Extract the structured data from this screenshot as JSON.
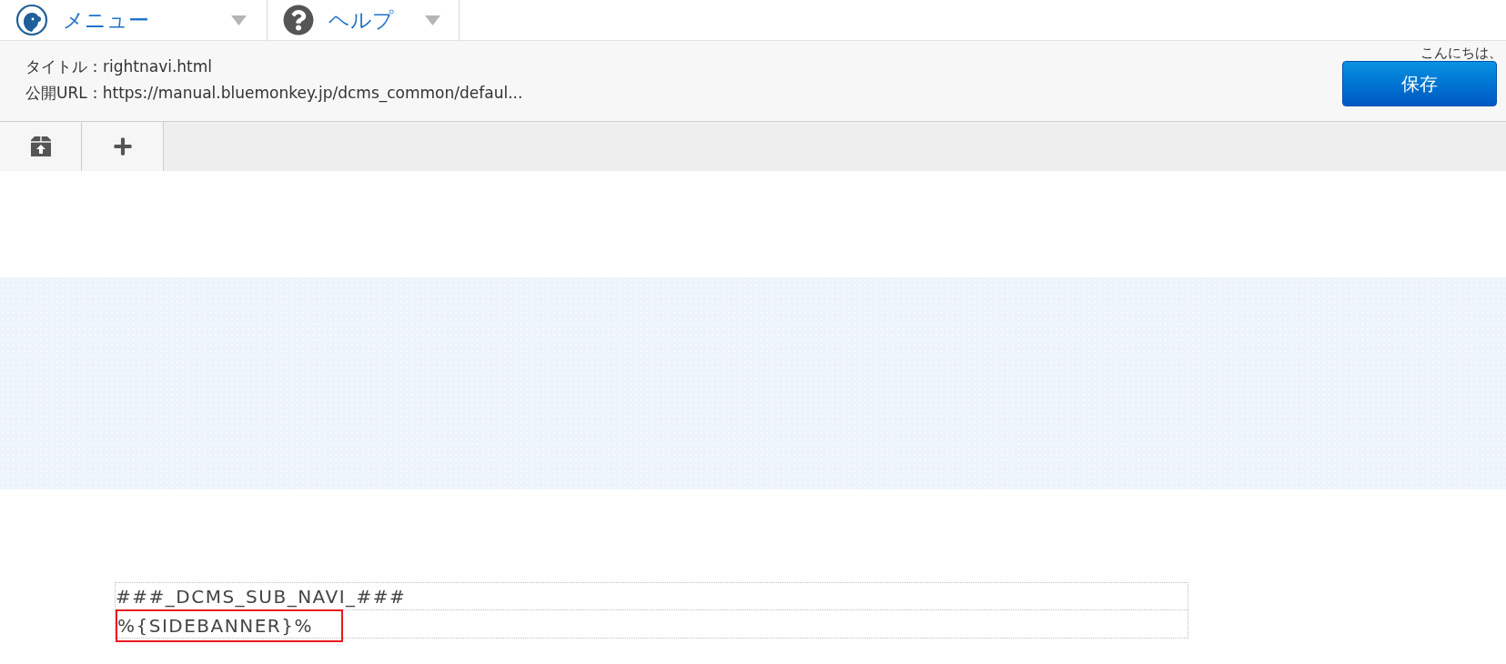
{
  "menubar": {
    "items": [
      {
        "label": "メニュー",
        "kind": "monkey"
      },
      {
        "label": "ヘルプ",
        "kind": "help"
      }
    ]
  },
  "header": {
    "title_line": "タイトル：rightnavi.html",
    "url_line": "公開URL：https://manual.bluemonkey.jp/dcms_common/defaul...",
    "greeting": "こんにちは、",
    "save_button": "保存"
  },
  "toolbar": {
    "items": [
      {
        "kind": "box-upload"
      },
      {
        "kind": "add"
      }
    ]
  },
  "content": {
    "rows": [
      {
        "text": "###_DCMS_SUB_NAVI_###",
        "highlighted": false
      },
      {
        "text": "%{SIDEBANNER}%",
        "highlighted": true
      }
    ]
  }
}
